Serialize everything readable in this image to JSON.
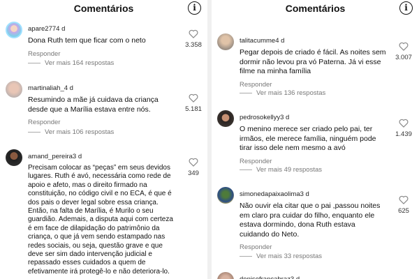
{
  "header_title": "Comentários",
  "reply_label": "Responder",
  "left": {
    "comments": [
      {
        "username": "apare277",
        "age": "4 d",
        "text": "Dona Ruth tem que ficar com o neto",
        "likes": "3.358",
        "more": "Ver mais 164 respostas"
      },
      {
        "username": "martinaliah_",
        "age": "4 d",
        "text": "Resumindo a mãe já cuidava da criança desde que a Marília estava entre nós.",
        "likes": "5.181",
        "more": "Ver mais 106 respostas"
      },
      {
        "username": "amand_pereira",
        "age": "3 d",
        "text": "Precisam colocar as “peças” em seus devidos lugares. Ruth é avó, necessária como rede de apoio e afeto, mas o direito firmado na constituição, no código civil e no ECA, é que é dos pais o dever legal sobre essa criança. Então, na falta de Marília, é Murilo o seu guardião. Ademais, a disputa aqui com certeza é em face de dilapidação do patrimônio da criança, o que já vem sendo estampado nas redes sociais, ou seja, questão grave e que deve ser sim dado intervenção judicial e repassado esses cuidados a quem de efetivamente irá protegê-lo e não deteriora-lo.",
        "likes": "349"
      }
    ]
  },
  "right": {
    "comments": [
      {
        "username": "talitacumme",
        "age": "4 d",
        "text": "Pegar depois de criado é  fácil. As noites sem dormir não  levou pra vó  Paterna. Já vi esse filme na minha família",
        "likes": "3.007",
        "more": "Ver mais 136 respostas"
      },
      {
        "username": "pedrosokellyy",
        "age": "3 d",
        "text": "O menino merece ser criado pelo pai, ter irmãos, ele merece família, ninguém pode tirar isso dele nem mesmo a avó",
        "likes": "1.439",
        "more": "Ver mais 49 respostas"
      },
      {
        "username": "simonedapaixaolima",
        "age": "3 d",
        "text": "Não ouvir ela citar que o pai ,passou noites em claro pra cuidar do filho, enquanto ele estava dormindo, dona Ruth estava cuidando do Neto.",
        "likes": "625",
        "more": "Ver mais 33 respostas"
      },
      {
        "username": "denisefrancabraz",
        "age": "3 d"
      }
    ]
  }
}
